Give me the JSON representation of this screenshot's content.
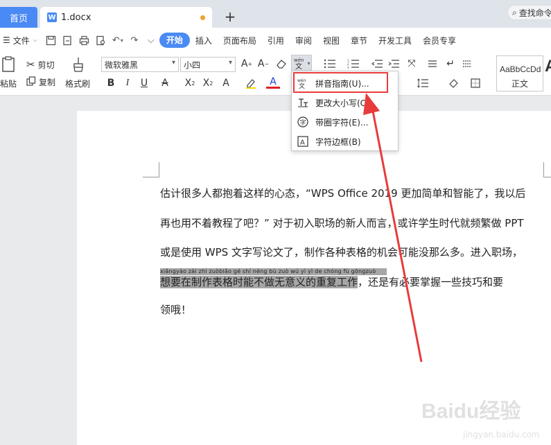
{
  "tabs": {
    "home": "首页",
    "document": "1.docx",
    "add": "+"
  },
  "menu": {
    "file": "文件",
    "items": [
      "开始",
      "插入",
      "页面布局",
      "引用",
      "审阅",
      "视图",
      "章节",
      "开发工具",
      "会员专享"
    ],
    "active": "开始",
    "search": "查找命令"
  },
  "ribbon": {
    "paste": "粘贴",
    "cut": "剪切",
    "copy": "复制",
    "format_painter": "格式刷",
    "font_name": "微软雅黑",
    "font_size": "小四",
    "bold": "B",
    "italic": "I",
    "underline": "U",
    "style_preview": "AaBbCcDd",
    "style_name": "正文",
    "style_big": "A"
  },
  "dropdown": {
    "items": [
      {
        "label": "拼音指南(U)...",
        "icon": "pinyin-icon"
      },
      {
        "label": "更改大小写(C)",
        "icon": "change-case-icon"
      },
      {
        "label": "带圈字符(E)...",
        "icon": "enclosed-char-icon"
      },
      {
        "label": "字符边框(B)",
        "icon": "char-border-icon"
      }
    ]
  },
  "document": {
    "line1": "估计很多人都抱着这样的心态，“WPS Office 2019 更加简单和智能了，我以后",
    "line2": "再也用不着教程了吧？” 对于初入职场的新人而言，或许学生时代就频繁做 PPT",
    "line3": "或是使用 WPS 文字写论文了，制作各种表格的机会可能没那么多。进入职场，",
    "pinyin": "xiǎngyào zài zhì zuòbiǎo gé shí néng bù zuò wú yì yì de chóng fù gōngzuò",
    "line4_highlight": "想要在制作表格时能不做无意义的重复工作",
    "line4_rest": "，还是有必要掌握一些技巧和要",
    "line5": "领哦！"
  },
  "watermark": {
    "text": "Baidu经验",
    "url": "jingyan.baidu.com"
  },
  "colors": {
    "accent": "#4a8af4",
    "highlight_border": "#e83b3b",
    "arrow": "#e83b3b",
    "selection": "#a6a6a6"
  }
}
